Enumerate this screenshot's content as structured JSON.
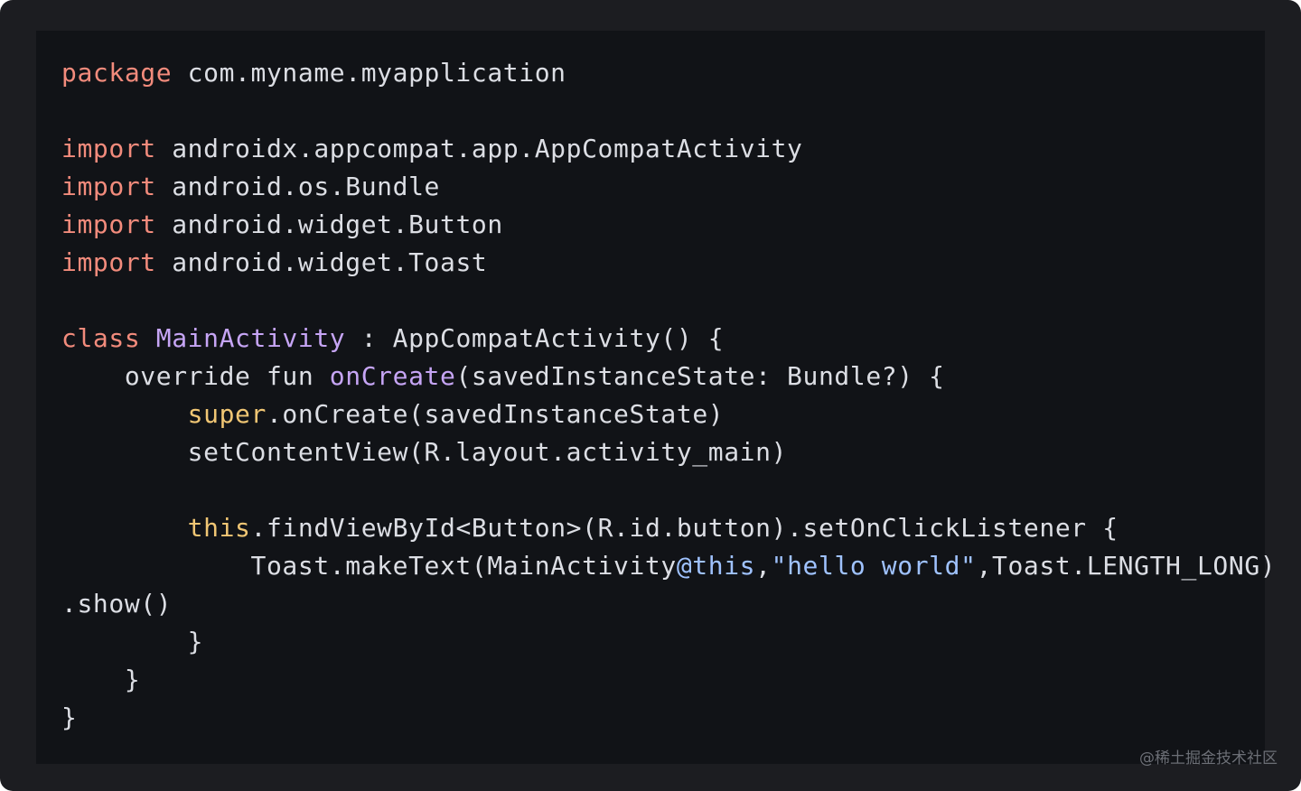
{
  "code_lines": [
    [
      {
        "t": "package",
        "c": "kw"
      },
      {
        "t": " com.myname.myapplication"
      }
    ],
    [],
    [
      {
        "t": "import",
        "c": "kw"
      },
      {
        "t": " androidx.appcompat.app.AppCompatActivity"
      }
    ],
    [
      {
        "t": "import",
        "c": "kw"
      },
      {
        "t": " android.os.Bundle"
      }
    ],
    [
      {
        "t": "import",
        "c": "kw"
      },
      {
        "t": " android.widget.Button"
      }
    ],
    [
      {
        "t": "import",
        "c": "kw"
      },
      {
        "t": " android.widget.Toast"
      }
    ],
    [],
    [
      {
        "t": "class",
        "c": "kw"
      },
      {
        "t": " "
      },
      {
        "t": "MainActivity",
        "c": "cls"
      },
      {
        "t": " : AppCompatActivity() {"
      }
    ],
    [
      {
        "t": "    override fun "
      },
      {
        "t": "onCreate",
        "c": "fn"
      },
      {
        "t": "(savedInstanceState: Bundle?) {"
      }
    ],
    [
      {
        "t": "        "
      },
      {
        "t": "super",
        "c": "yel"
      },
      {
        "t": ".onCreate(savedInstanceState)"
      }
    ],
    [
      {
        "t": "        setContentView(R.layout.activity_main)"
      }
    ],
    [],
    [
      {
        "t": "        "
      },
      {
        "t": "this",
        "c": "yel"
      },
      {
        "t": ".findViewById<Button>(R.id.button).setOnClickListener {"
      }
    ],
    [
      {
        "t": "            Toast.makeText(MainActivity"
      },
      {
        "t": "@this",
        "c": "str"
      },
      {
        "t": ","
      },
      {
        "t": "\"hello world\"",
        "c": "str"
      },
      {
        "t": ",Toast.LENGTH_LONG)"
      }
    ],
    [
      {
        "t": ".show()"
      }
    ],
    [
      {
        "t": "        }"
      }
    ],
    [
      {
        "t": "    }"
      }
    ],
    [
      {
        "t": "}"
      }
    ]
  ],
  "watermark": "@稀土掘金技术社区",
  "colors": {
    "frame": "#1c1d21",
    "panel": "#111317",
    "text": "#dcdee4",
    "keyword": "#f28b7c",
    "class_name": "#c6a5f5",
    "this_super": "#f0c674",
    "string": "#9fc2ff"
  }
}
